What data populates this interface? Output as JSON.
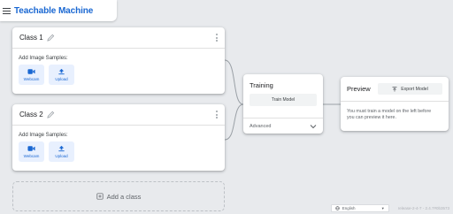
{
  "header": {
    "title": "Teachable Machine",
    "menu_icon": "hamburger-icon"
  },
  "classes": [
    {
      "name": "Class 1",
      "samples_label": "Add Image Samples:",
      "webcam_label": "Webcam",
      "upload_label": "Upload"
    },
    {
      "name": "Class 2",
      "samples_label": "Add Image Samples:",
      "webcam_label": "Webcam",
      "upload_label": "Upload"
    }
  ],
  "add_class": {
    "label": "Add a class",
    "icon": "add-box-icon"
  },
  "training": {
    "title": "Training",
    "train_button": "Train Model",
    "advanced_label": "Advanced"
  },
  "preview": {
    "title": "Preview",
    "export_button": "Export Model",
    "message": "You must train a model on the left before you can preview it here."
  },
  "footer": {
    "language": "English",
    "version": "release-2-4-7 - 2.4.7#0b3573"
  },
  "colors": {
    "accent": "#1967d2",
    "background": "#e8eaed",
    "sample_button_bg": "#e8f0fe"
  }
}
